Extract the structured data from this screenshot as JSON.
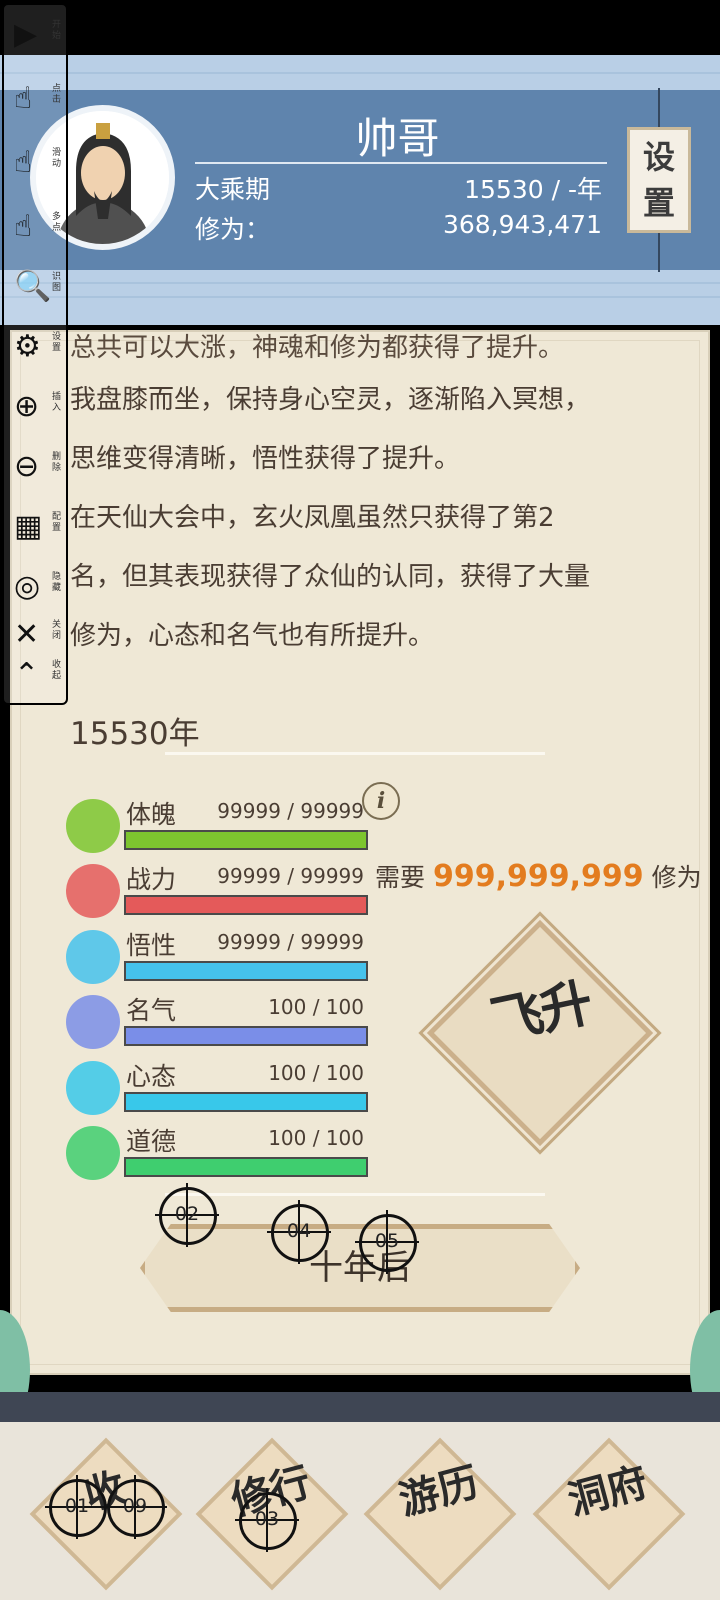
{
  "header": {
    "name": "帅哥",
    "realm": "大乘期",
    "years": "15530 / -年",
    "cultivation_label": "修为：",
    "cultivation_value": "368,943,471",
    "settings_label": "设置"
  },
  "story": {
    "lines": [
      "在天仙大会中，玄火凤凰虽然只获得了第2",
      "我盘膝而坐，保持身心空灵，逐渐陷入冥想，",
      "思维变得清晰，悟性获得了提升。",
      "在天仙大会中，玄火凤凰虽然只获得了第2",
      "名，但其表现获得了众仙的认同，获得了大量",
      "修为，心态和名气也有所提升。"
    ],
    "partial_top": "总共可以大涨，神魂和修为都获得了提升。",
    "year_heading": "15530年"
  },
  "stats": [
    {
      "label": "体魄",
      "value": "99999 / 99999",
      "fill": 1.0,
      "color": "#7dc52f",
      "icon": "body-icon"
    },
    {
      "label": "战力",
      "value": "99999 / 99999",
      "fill": 1.0,
      "color": "#e45a5a",
      "icon": "dragon-icon"
    },
    {
      "label": "悟性",
      "value": "99999 / 99999",
      "fill": 1.0,
      "color": "#45c2ec",
      "icon": "book-icon"
    },
    {
      "label": "名气",
      "value": "100 / 100",
      "fill": 1.0,
      "color": "#7a8ee8",
      "icon": "fan-icon"
    },
    {
      "label": "心态",
      "value": "100 / 100",
      "fill": 1.0,
      "color": "#38c8ea",
      "icon": "yinyang-icon"
    },
    {
      "label": "道德",
      "value": "100 / 100",
      "fill": 1.0,
      "color": "#3fce6f",
      "icon": "flower-icon"
    }
  ],
  "ascend": {
    "need_prefix": "需要",
    "need_amount": "999,999,999",
    "need_suffix": "修为",
    "button_label": "飞升"
  },
  "ten_year_label": "十年后",
  "nav": {
    "items": [
      "收",
      "修行",
      "游历",
      "洞府"
    ]
  },
  "toolbar": {
    "items": [
      {
        "glyph": "▶",
        "label": "开始",
        "icon": "play-icon"
      },
      {
        "glyph": "☝",
        "label": "点击",
        "icon": "tap-icon"
      },
      {
        "glyph": "☝",
        "label": "滑动",
        "icon": "swipe-icon"
      },
      {
        "glyph": "☝",
        "label": "多点",
        "icon": "multi-tap-icon"
      },
      {
        "glyph": "🔍",
        "label": "识图",
        "icon": "image-search-icon"
      },
      {
        "glyph": "⚙",
        "label": "设置",
        "icon": "gear-icon"
      },
      {
        "glyph": "⊕",
        "label": "插入",
        "icon": "add-icon"
      },
      {
        "glyph": "⊖",
        "label": "删除",
        "icon": "remove-icon"
      },
      {
        "glyph": "▦",
        "label": "配置",
        "icon": "config-icon"
      },
      {
        "glyph": "◎",
        "label": "隐藏",
        "icon": "hide-icon"
      },
      {
        "glyph": "✕",
        "label": "关闭",
        "icon": "close-icon"
      },
      {
        "glyph": "⌃",
        "label": "收起",
        "icon": "collapse-icon"
      }
    ]
  },
  "markers": [
    "01",
    "02",
    "03",
    "04",
    "05",
    "09"
  ]
}
